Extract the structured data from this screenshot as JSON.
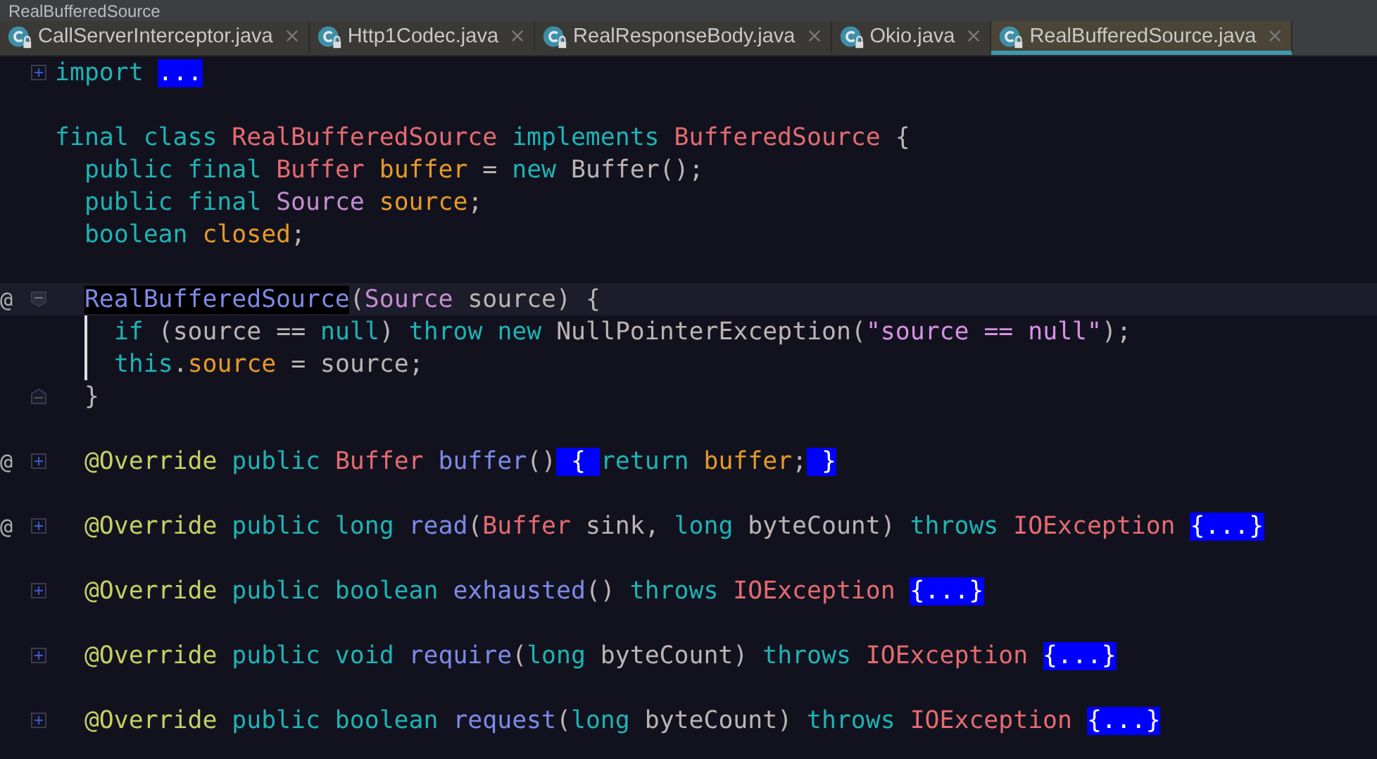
{
  "breadcrumb": "RealBufferedSource",
  "tabs": [
    {
      "label": "CallServerInterceptor.java",
      "selected": false
    },
    {
      "label": "Http1Codec.java",
      "selected": false
    },
    {
      "label": "RealResponseBody.java",
      "selected": false
    },
    {
      "label": "Okio.java",
      "selected": false
    },
    {
      "label": "RealBufferedSource.java",
      "selected": true
    }
  ],
  "lines": [
    {
      "kind": "code",
      "collapsed": true,
      "tokens": [
        {
          "kind": "kw",
          "text": "import "
        },
        {
          "kind": "folded",
          "text": "..."
        }
      ]
    },
    {
      "kind": "blank"
    },
    {
      "kind": "code",
      "tokens": [
        {
          "kind": "kw",
          "text": "final class "
        },
        {
          "kind": "type",
          "text": "RealBufferedSource"
        },
        {
          "kind": "kw",
          "text": " implements "
        },
        {
          "kind": "type",
          "text": "BufferedSource"
        },
        {
          "kind": "plain",
          "text": " {"
        }
      ],
      "children": [
        {
          "kind": "code",
          "tokens": [
            {
              "kind": "kw",
              "text": "public final "
            },
            {
              "kind": "type",
              "text": "Buffer"
            },
            {
              "kind": "field",
              "text": " buffer"
            },
            {
              "kind": "plain",
              "text": " = "
            },
            {
              "kind": "kw",
              "text": "new "
            },
            {
              "kind": "plain",
              "text": "Buffer();"
            }
          ]
        },
        {
          "kind": "code",
          "tokens": [
            {
              "kind": "kw",
              "text": "public final "
            },
            {
              "kind": "iface",
              "text": "Source"
            },
            {
              "kind": "field",
              "text": " source"
            },
            {
              "kind": "plain",
              "text": ";"
            }
          ]
        },
        {
          "kind": "code",
          "tokens": [
            {
              "kind": "kw",
              "text": "boolean "
            },
            {
              "kind": "field",
              "text": "closed"
            },
            {
              "kind": "plain",
              "text": ";"
            }
          ]
        },
        {
          "kind": "blank"
        },
        {
          "kind": "code",
          "marker": "@",
          "collapsed": false,
          "current": true,
          "tokens": [
            {
              "kind": "method-hl",
              "text": "RealBufferedSource"
            },
            {
              "kind": "plain",
              "text": "("
            },
            {
              "kind": "iface",
              "text": "Source"
            },
            {
              "kind": "plain",
              "text": " source) {"
            }
          ],
          "children": [
            {
              "kind": "code",
              "scope": true,
              "tokens": [
                {
                  "kind": "kw",
                  "text": "if "
                },
                {
                  "kind": "plain",
                  "text": "(source == "
                },
                {
                  "kind": "kw",
                  "text": "null"
                },
                {
                  "kind": "plain",
                  "text": ") "
                },
                {
                  "kind": "kw",
                  "text": "throw new "
                },
                {
                  "kind": "plain",
                  "text": "NullPointerException("
                },
                {
                  "kind": "str",
                  "text": "\"source == null\""
                },
                {
                  "kind": "plain",
                  "text": ");"
                }
              ]
            },
            {
              "kind": "code",
              "scope": true,
              "tokens": [
                {
                  "kind": "kw",
                  "text": "this"
                },
                {
                  "kind": "plain",
                  "text": "."
                },
                {
                  "kind": "field",
                  "text": "source"
                },
                {
                  "kind": "plain",
                  "text": " = source;"
                }
              ]
            }
          ]
        },
        {
          "kind": "code",
          "fold_end": true,
          "tokens": [
            {
              "kind": "plain",
              "text": "}"
            }
          ]
        },
        {
          "kind": "blank"
        },
        {
          "kind": "code",
          "marker": "@",
          "collapsed": true,
          "tokens": [
            {
              "kind": "anno",
              "text": "@Override "
            },
            {
              "kind": "kw",
              "text": "public "
            },
            {
              "kind": "type",
              "text": "Buffer "
            },
            {
              "kind": "method",
              "text": "buffer"
            },
            {
              "kind": "plain",
              "text": "()"
            },
            {
              "kind": "folded",
              "text": " { "
            },
            {
              "kind": "kw",
              "text": "return "
            },
            {
              "kind": "field",
              "text": "buffer"
            },
            {
              "kind": "plain",
              "text": ";"
            },
            {
              "kind": "folded",
              "text": " }"
            }
          ]
        },
        {
          "kind": "blank"
        },
        {
          "kind": "code",
          "marker": "@",
          "collapsed": true,
          "tokens": [
            {
              "kind": "anno",
              "text": "@Override "
            },
            {
              "kind": "kw",
              "text": "public long "
            },
            {
              "kind": "method",
              "text": "read"
            },
            {
              "kind": "plain",
              "text": "("
            },
            {
              "kind": "type",
              "text": "Buffer"
            },
            {
              "kind": "plain",
              "text": " sink, "
            },
            {
              "kind": "kw",
              "text": "long"
            },
            {
              "kind": "plain",
              "text": " byteCount) "
            },
            {
              "kind": "kw",
              "text": "throws "
            },
            {
              "kind": "type",
              "text": "IOException "
            },
            {
              "kind": "folded",
              "text": "{...}"
            }
          ]
        },
        {
          "kind": "blank"
        },
        {
          "kind": "code",
          "collapsed": true,
          "tokens": [
            {
              "kind": "anno",
              "text": "@Override "
            },
            {
              "kind": "kw",
              "text": "public boolean "
            },
            {
              "kind": "method",
              "text": "exhausted"
            },
            {
              "kind": "plain",
              "text": "() "
            },
            {
              "kind": "kw",
              "text": "throws "
            },
            {
              "kind": "type",
              "text": "IOException "
            },
            {
              "kind": "folded",
              "text": "{...}"
            }
          ]
        },
        {
          "kind": "blank"
        },
        {
          "kind": "code",
          "collapsed": true,
          "tokens": [
            {
              "kind": "anno",
              "text": "@Override "
            },
            {
              "kind": "kw",
              "text": "public void "
            },
            {
              "kind": "method",
              "text": "require"
            },
            {
              "kind": "plain",
              "text": "("
            },
            {
              "kind": "kw",
              "text": "long"
            },
            {
              "kind": "plain",
              "text": " byteCount) "
            },
            {
              "kind": "kw",
              "text": "throws "
            },
            {
              "kind": "type",
              "text": "IOException "
            },
            {
              "kind": "folded",
              "text": "{...}"
            }
          ]
        },
        {
          "kind": "blank"
        },
        {
          "kind": "code",
          "collapsed": true,
          "tokens": [
            {
              "kind": "anno",
              "text": "@Override "
            },
            {
              "kind": "kw",
              "text": "public boolean "
            },
            {
              "kind": "method",
              "text": "request"
            },
            {
              "kind": "plain",
              "text": "("
            },
            {
              "kind": "kw",
              "text": "long"
            },
            {
              "kind": "plain",
              "text": " byteCount) "
            },
            {
              "kind": "kw",
              "text": "throws "
            },
            {
              "kind": "type",
              "text": "IOException "
            },
            {
              "kind": "folded",
              "text": "{...}"
            }
          ]
        }
      ]
    }
  ]
}
